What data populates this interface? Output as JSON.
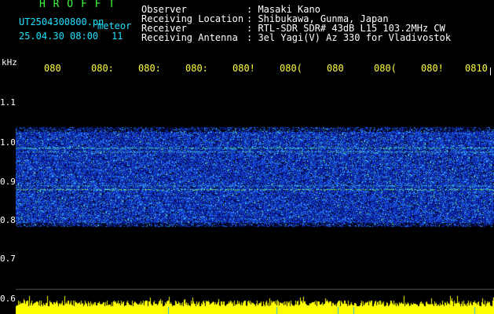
{
  "brand": "H R O F F T",
  "file": {
    "name": "UT2504300800.pn",
    "kind": "meteor",
    "stamp": "25.04.30 08:00",
    "count": "11"
  },
  "header": [
    {
      "label": "Observer",
      "value": ": Masaki Kano"
    },
    {
      "label": "Receiving Location",
      "value": ": Shibukawa, Gunma, Japan"
    },
    {
      "label": "Receiver",
      "value": ": RTL-SDR SDR# 43dB L15 103.2MHz CW"
    },
    {
      "label": "Receiving Antenna",
      "value": ": 3el Yagi(V) Az 330 for Vladivostok"
    }
  ],
  "y_unit": "kHz",
  "y_ticks": [
    "1.1",
    "1.0",
    "0.9",
    "0.8",
    "0.7",
    "0.6"
  ],
  "x_ticks": [
    "080",
    "080:",
    "080:",
    "080:",
    "080!",
    "080(",
    "080",
    "080(",
    "080!",
    "0810"
  ],
  "colors": {
    "brand": "#3cff3c",
    "filename": "#20e0ff",
    "labels": "#ffffff",
    "ticks": "#ffff40",
    "power": "#ffff00"
  }
}
